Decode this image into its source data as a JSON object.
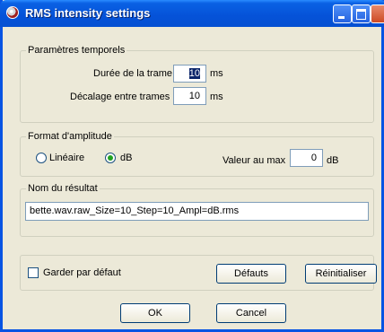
{
  "window": {
    "title": "RMS intensity settings"
  },
  "temporal": {
    "legend": "Paramètres temporels",
    "frame_duration_label": "Durée de la trame",
    "frame_duration_value": "10",
    "frame_duration_unit": "ms",
    "frame_step_label": "Décalage entre trames",
    "frame_step_value": "10",
    "frame_step_unit": "ms"
  },
  "amplitude": {
    "legend": "Format d'amplitude",
    "linear_label": "Linéaire",
    "db_label": "dB",
    "selected": "dB",
    "max_label": "Valeur au max",
    "max_value": "0",
    "max_unit": "dB"
  },
  "result": {
    "legend": "Nom du résultat",
    "filename": "bette.wav.raw_Size=10_Step=10_Ampl=dB.rms"
  },
  "options": {
    "keep_default_label": "Garder par défaut",
    "keep_default_checked": false,
    "defaults_button": "Défauts",
    "reset_button": "Réinitialiser"
  },
  "actions": {
    "ok": "OK",
    "cancel": "Cancel"
  }
}
